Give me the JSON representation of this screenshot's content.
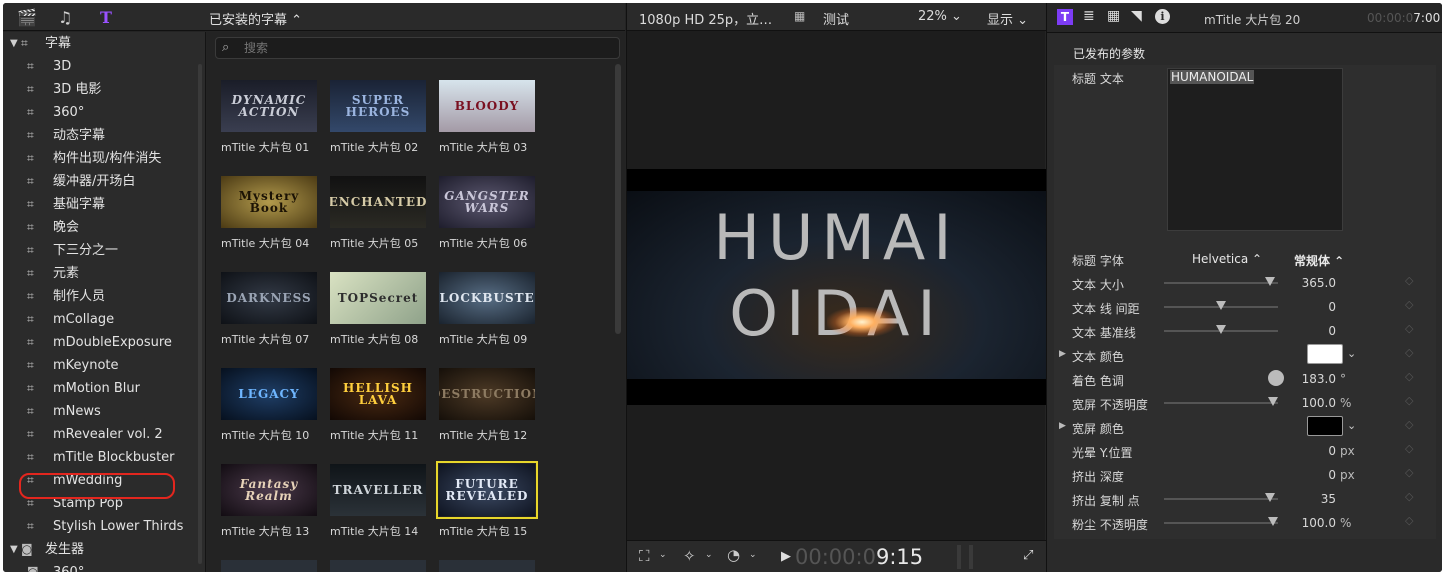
{
  "browser": {
    "library_title": "已安装的字幕 ⌃",
    "search_placeholder": "搜索",
    "categories": [
      {
        "label": "字幕"
      },
      {
        "label": "发生器"
      }
    ],
    "items": [
      {
        "label": "3D"
      },
      {
        "label": "3D 电影"
      },
      {
        "label": "360°"
      },
      {
        "label": "动态字幕"
      },
      {
        "label": "构件出现/构件消失"
      },
      {
        "label": "缓冲器/开场白"
      },
      {
        "label": "基础字幕"
      },
      {
        "label": "晚会"
      },
      {
        "label": "下三分之一"
      },
      {
        "label": "元素"
      },
      {
        "label": "制作人员"
      },
      {
        "label": "mCollage"
      },
      {
        "label": "mDoubleExposure"
      },
      {
        "label": "mKeynote"
      },
      {
        "label": "mMotion Blur"
      },
      {
        "label": "mNews"
      },
      {
        "label": "mRevealer vol. 2"
      },
      {
        "label": "mTitle Blockbuster"
      },
      {
        "label": "mWedding"
      },
      {
        "label": "Stamp Pop"
      },
      {
        "label": "Stylish Lower Thirds"
      },
      {
        "label": "360°"
      }
    ],
    "selected_item": "mTitle Blockbuster"
  },
  "grid": {
    "tiles": [
      {
        "caption": "mTitle 大片包 01",
        "thumb_text": "DYNAMIC ACTION"
      },
      {
        "caption": "mTitle 大片包 02",
        "thumb_text": "SUPER HEROES"
      },
      {
        "caption": "mTitle 大片包 03",
        "thumb_text": "BLOODY"
      },
      {
        "caption": "mTitle 大片包 04",
        "thumb_text": "Mystery Book"
      },
      {
        "caption": "mTitle 大片包 05",
        "thumb_text": "ENCHANTED"
      },
      {
        "caption": "mTitle 大片包 06",
        "thumb_text": "GANGSTER WARS"
      },
      {
        "caption": "mTitle 大片包 07",
        "thumb_text": "DARKNESS"
      },
      {
        "caption": "mTitle 大片包 08",
        "thumb_text": "TOPSecret"
      },
      {
        "caption": "mTitle 大片包 09",
        "thumb_text": "BLOCKBUSTER"
      },
      {
        "caption": "mTitle 大片包 10",
        "thumb_text": "LEGACY"
      },
      {
        "caption": "mTitle 大片包 11",
        "thumb_text": "HELLISH LAVA"
      },
      {
        "caption": "mTitle 大片包 12",
        "thumb_text": "DESTRUCTION"
      },
      {
        "caption": "mTitle 大片包 13",
        "thumb_text": "Fantasy Realm"
      },
      {
        "caption": "mTitle 大片包 14",
        "thumb_text": "TRAVELLER"
      },
      {
        "caption": "mTitle 大片包 15",
        "thumb_text": "FUTURE REVEALED"
      }
    ],
    "selected_index": 14
  },
  "viewer": {
    "format": "1080p HD 25p，立…",
    "project": "测试",
    "zoom": "22% ⌄",
    "display": "显示 ⌄",
    "image_line1": "HUMAI",
    "image_line2": "OIDAI",
    "timecode_dim": "00:00:0",
    "timecode_bright": "9:15"
  },
  "inspector": {
    "clip_title": "mTitle 大片包 20",
    "timecode_dim": "00:00:0",
    "timecode_bright": "7:00",
    "section_title": "已发布的参数",
    "title_text_label": "标题 文本",
    "title_text_value": "HUMANOIDAL",
    "font_label": "标题 字体",
    "font_value": "Helvetica ⌃",
    "style_value": "常规体 ⌃",
    "params": [
      {
        "label": "文本 大小",
        "value": "365.0",
        "unit": "",
        "type": "slider",
        "level": 0.97
      },
      {
        "label": "文本 线 间距",
        "value": "0",
        "unit": "",
        "type": "slider",
        "level": 0.5
      },
      {
        "label": "文本 基准线",
        "value": "0",
        "unit": "",
        "type": "slider",
        "level": 0.5
      },
      {
        "label": "文本 颜色",
        "value": "",
        "unit": "",
        "type": "color",
        "color": "#ffffff"
      },
      {
        "label": "着色 色调",
        "value": "183.0",
        "unit": "°",
        "type": "dial"
      },
      {
        "label": "宽屏 不透明度",
        "value": "100.0",
        "unit": "%",
        "type": "slider",
        "level": 1.0
      },
      {
        "label": "宽屏 颜色",
        "value": "",
        "unit": "",
        "type": "color",
        "color": "#000000"
      },
      {
        "label": "光晕 Y.位置",
        "value": "0",
        "unit": "px",
        "type": "plain"
      },
      {
        "label": "挤出 深度",
        "value": "0",
        "unit": "px",
        "type": "plain"
      },
      {
        "label": "挤出 复制 点",
        "value": "35",
        "unit": "",
        "type": "slider",
        "level": 0.97
      },
      {
        "label": "粉尘 不透明度",
        "value": "100.0",
        "unit": "%",
        "type": "slider",
        "level": 1.0
      }
    ]
  },
  "colors": {
    "selection_ring": "#e3261e",
    "selected_tile_border": "#e7d62b",
    "inspector_tab_active": "#7d3cf5"
  }
}
